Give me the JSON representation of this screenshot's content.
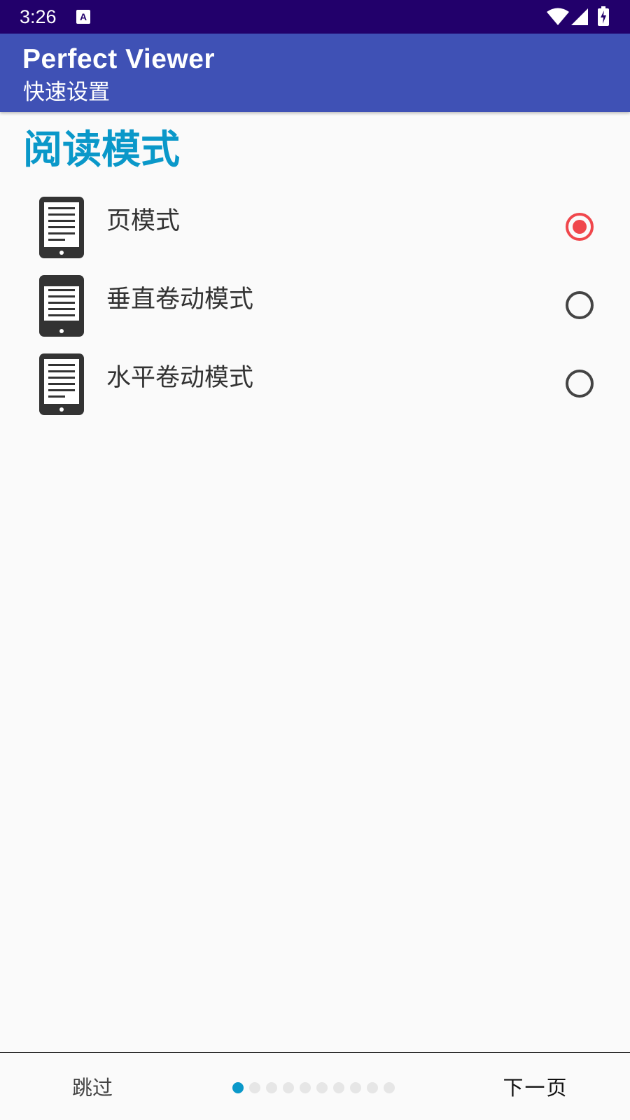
{
  "status_bar": {
    "time": "3:26",
    "icons": [
      "a-notification-icon",
      "wifi-icon",
      "signal-icon",
      "battery-charging-icon"
    ]
  },
  "app_bar": {
    "title": "Perfect Viewer",
    "subtitle": "快速设置"
  },
  "section": {
    "title": "阅读模式",
    "accent_color": "#0a98c9"
  },
  "options": [
    {
      "label": "页模式",
      "icon": "ereader-page-icon",
      "selected": true
    },
    {
      "label": "垂直卷动模式",
      "icon": "ereader-vertical-scroll-icon",
      "selected": false
    },
    {
      "label": "水平卷动模式",
      "icon": "ereader-horizontal-scroll-icon",
      "selected": false
    }
  ],
  "bottom_bar": {
    "skip_label": "跳过",
    "next_label": "下一页",
    "page_count": 10,
    "current_page": 1
  },
  "colors": {
    "status_bar": "#22006b",
    "app_bar": "#3f51b5",
    "radio_selected": "#f0474c",
    "radio_unselected": "#444444",
    "indicator_active": "#0a98c9",
    "indicator_inactive": "#e6e6e6"
  }
}
